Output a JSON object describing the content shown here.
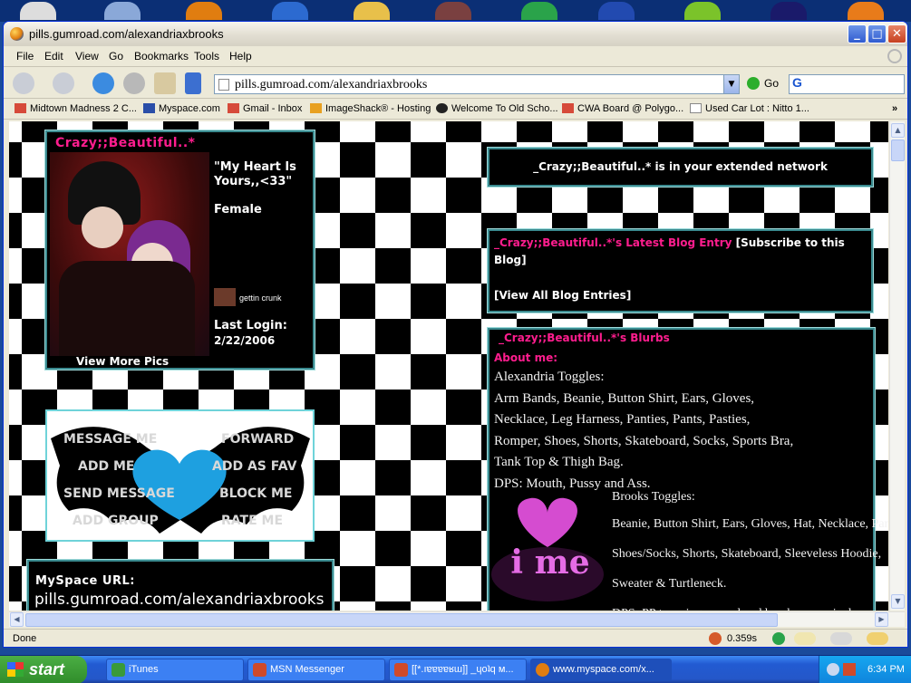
{
  "window": {
    "title": "pills.gumroad.com/alexandriaxbrooks"
  },
  "menu": [
    "File",
    "Edit",
    "View",
    "Go",
    "Bookmarks",
    "Tools",
    "Help"
  ],
  "address": {
    "url": "pills.gumroad.com/alexandriaxbrooks",
    "go_label": "Go",
    "search_prefix": "G"
  },
  "bookmarks": [
    "Midtown Madness 2 C...",
    "Myspace.com",
    "Gmail - Inbox",
    "ImageShack® - Hosting",
    "Welcome To Old Scho...",
    "CWA Board @ Polygo...",
    "Used Car Lot : Nitto 1..."
  ],
  "bookmarks_more": "»",
  "profile": {
    "name": "Crazy;;Beautiful..*",
    "headline": "\"My Heart Is Yours,,<33\"",
    "gender": "Female",
    "mood": "gettin crunk",
    "last_login_label": "Last Login:",
    "last_login_date": "2/22/2006",
    "view_more": "View More Pics"
  },
  "contact": {
    "left": [
      "MESSAGE ME",
      "ADD ME",
      "SEND MESSAGE",
      "ADD GROUP"
    ],
    "right": [
      "FORWARD",
      "ADD AS FAV",
      "BLOCK ME",
      "RATE ME"
    ]
  },
  "url_box": {
    "label": "MySpace URL:",
    "url": "pills.gumroad.com/alexandriaxbrooks"
  },
  "network": "_Crazy;;Beautiful..* is in your extended network",
  "blog": {
    "title_pink": "_Crazy;;Beautiful..*'s Latest Blog Entry",
    "subscribe": "[Subscribe to this Blog]",
    "view_all": "[View All Blog Entries]"
  },
  "blurbs": {
    "title": "_Crazy;;Beautiful..*'s Blurbs",
    "about_label": "About me:",
    "lines": [
      "Alexandria Toggles:",
      "Arm Bands, Beanie, Button Shirt, Ears, Gloves,",
      "Necklace, Leg Harness, Panties, Pants, Pasties,",
      "Romper, Shoes, Shorts, Skateboard, Socks, Sports Bra,",
      "Tank Top & Thigh Bag.",
      "DPS: Mouth, Pussy and Ass."
    ],
    "brooks": [
      "Brooks Toggles:",
      "Beanie, Button Shirt, Ears, Gloves, Hat, Necklace, Pants,",
      "Shoes/Socks, Shorts, Skateboard, Sleeveless Hoodie,",
      "Sweater & Turtleneck.",
      "DPS: PP to swing around and break some pixels."
    ],
    "graphic_text": "i me"
  },
  "statusbar": {
    "left": "Done",
    "timing": "0.359s"
  },
  "taskbar": {
    "start": "start",
    "tasks": [
      "iTunes",
      "MSN Messenger",
      "[[*.ıɐɐɐɐʁɯ]] _ɥoʇq м...",
      "www.myspace.com/x..."
    ],
    "clock": "6:34 PM"
  },
  "colors": {
    "pink": "#ff1d8e",
    "teal_border": "#3a8a8f",
    "heart": "#1ea0e0"
  }
}
